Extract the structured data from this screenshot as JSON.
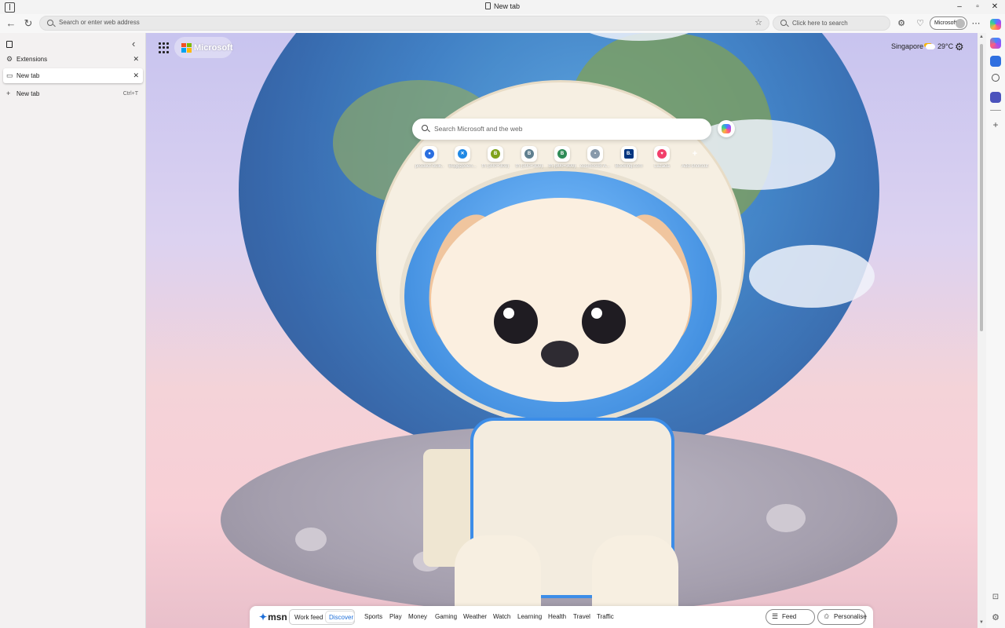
{
  "window": {
    "title": "New tab"
  },
  "toolbar": {
    "address_placeholder": "Search or enter web address",
    "bing_placeholder": "Click here to search",
    "profile_label": "Microsoft"
  },
  "vertical_tabs": {
    "tabs": [
      {
        "label": "Extensions",
        "active": false
      },
      {
        "label": "New tab",
        "active": true
      }
    ],
    "new_tab_label": "New tab",
    "new_tab_shortcut": "Ctrl+T"
  },
  "ntp": {
    "brand": "Microsoft",
    "weather": {
      "city": "Singapore",
      "temp": "29°C"
    },
    "search_placeholder": "Search Microsoft and the web",
    "shortcuts": [
      {
        "label": "product-bulk..",
        "color": "#2b6fe0",
        "glyph": "●"
      },
      {
        "label": "Buggzpoen...",
        "color": "#1e88e5",
        "glyph": "✕"
      },
      {
        "label": "th (300×300)",
        "color": "#7fa21a",
        "glyph": "B"
      },
      {
        "label": "th (300×300)",
        "color": "#5f7f8f",
        "glyph": "B"
      },
      {
        "label": "th (300×300)",
        "color": "#2e8b57",
        "glyph": "B"
      },
      {
        "label": "cosmos08 A...",
        "color": "#8899aa",
        "glyph": "•"
      },
      {
        "label": "Booking.com",
        "color": "#003580",
        "glyph": "B."
      },
      {
        "label": "Lazada",
        "color": "#f23f6a",
        "glyph": "♥"
      },
      {
        "label": "Add shortcut",
        "color": "#ffffff",
        "glyph": "+"
      }
    ]
  },
  "msn": {
    "logo": "msn",
    "feed_options": [
      "Work feed",
      "Discover"
    ],
    "selected_feed": "Discover",
    "categories": [
      "Sports",
      "Play",
      "Money",
      "Gaming",
      "Weather",
      "Watch",
      "Learning",
      "Health",
      "Travel",
      "Traffic"
    ],
    "feed_layout_label": "Feed layout",
    "personalise_label": "Personalise"
  },
  "colors": {
    "accent": "#1e6fd9"
  }
}
